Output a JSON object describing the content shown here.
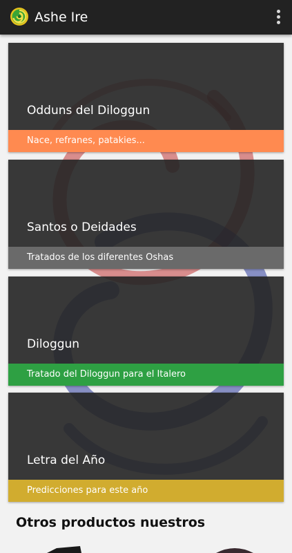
{
  "app": {
    "title": "Ashe Ire",
    "logo_icon": "green-spiral-logo-icon"
  },
  "theme": {
    "appbar": "#222222",
    "page_background": "#f2f2f2",
    "card_background": "#2a2a2a",
    "swirl_colors": [
      "#c23a3a",
      "#2f3e9e"
    ]
  },
  "cards": [
    {
      "title": "Odduns del Diloggun",
      "subtitle": "Nace, refranes, patakies...",
      "band_color": "#ff8a50"
    },
    {
      "title": "Santos o Deidades",
      "subtitle": "Tratados de los diferentes Oshas",
      "band_color": "#6a6a6a"
    },
    {
      "title": "Diloggun",
      "subtitle": "Tratado del Diloggun para el Italero",
      "band_color": "#2ea043"
    },
    {
      "title": "Letra del Año",
      "subtitle": "Predicciones para este año",
      "band_color": "#d1ac2f"
    }
  ],
  "products": {
    "heading": "Otros productos nuestros"
  }
}
